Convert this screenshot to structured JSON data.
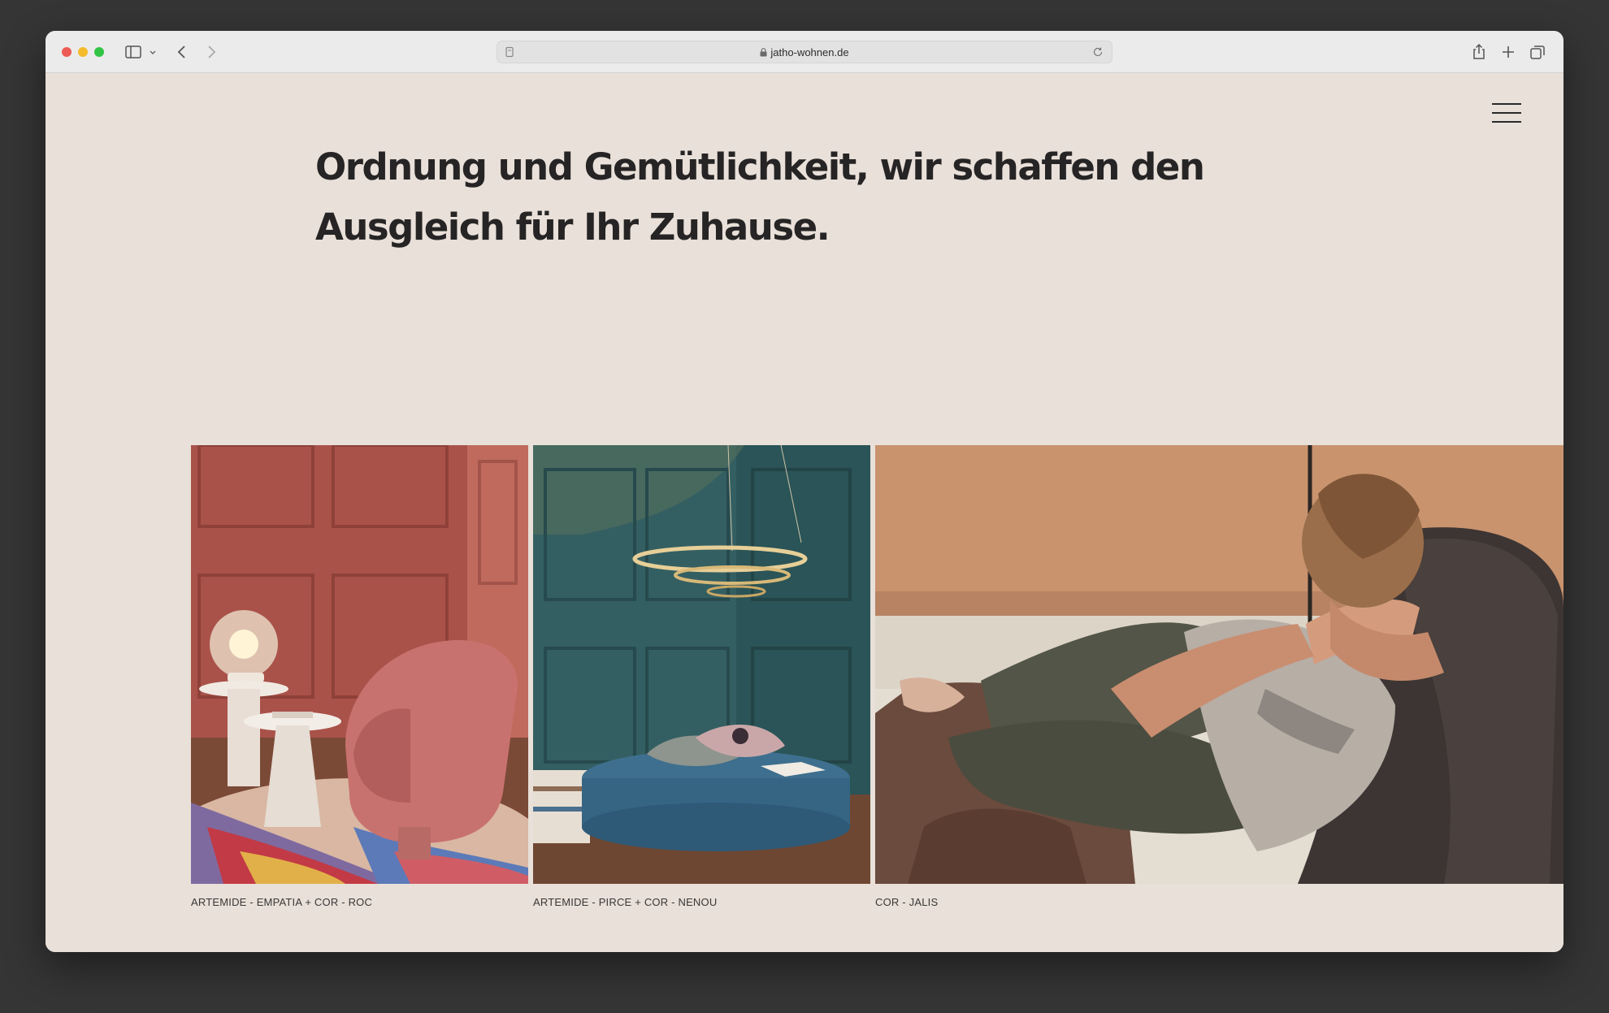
{
  "browser": {
    "url": "jatho-wohnen.de"
  },
  "page": {
    "headline_line1": "Ordnung und Gemütlichkeit, wir schaffen den",
    "headline_line2": "Ausgleich für Ihr Zuhause."
  },
  "gallery": [
    {
      "caption": "ARTEMIDE - EMPATIA + COR - ROC",
      "icon": "lamp-armchair-photo"
    },
    {
      "caption": "ARTEMIDE - PIRCE + COR - NENOU",
      "icon": "pendant-pouf-photo"
    },
    {
      "caption": "COR - JALIS",
      "icon": "man-lounge-chair-photo"
    }
  ],
  "colors": {
    "page_bg": "#e8e0d9",
    "text": "#262424"
  }
}
